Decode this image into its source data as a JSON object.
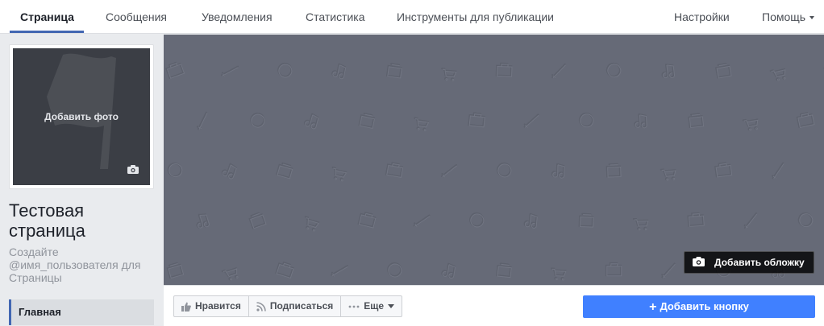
{
  "nav": {
    "tabs": [
      {
        "label": "Страница",
        "active": true
      },
      {
        "label": "Сообщения"
      },
      {
        "label": "Уведомления"
      },
      {
        "label": "Статистика"
      },
      {
        "label": "Инструменты для публикации"
      }
    ],
    "settings_label": "Настройки",
    "help_label": "Помощь"
  },
  "profile": {
    "add_photo_label": "Добавить фото",
    "page_name": "Тестовая страница",
    "username_hint": "Создайте @имя_пользователя для Страницы"
  },
  "leftnav": {
    "items": [
      {
        "label": "Главная",
        "active": true
      }
    ]
  },
  "cover": {
    "add_cover_label": "Добавить обложку"
  },
  "actions": {
    "like_label": "Нравится",
    "follow_label": "Подписаться",
    "more_label": "Еще",
    "add_button_label": "Добавить кнопку"
  },
  "colors": {
    "accent": "#4267b2",
    "cta": "#4080ff",
    "cover_bg": "#666a77",
    "profile_bg": "#3b3e45"
  },
  "icons": [
    "flag-icon",
    "camera-icon",
    "like-icon",
    "rss-icon",
    "more-dots-icon",
    "plus-icon",
    "chevron-down-icon"
  ]
}
